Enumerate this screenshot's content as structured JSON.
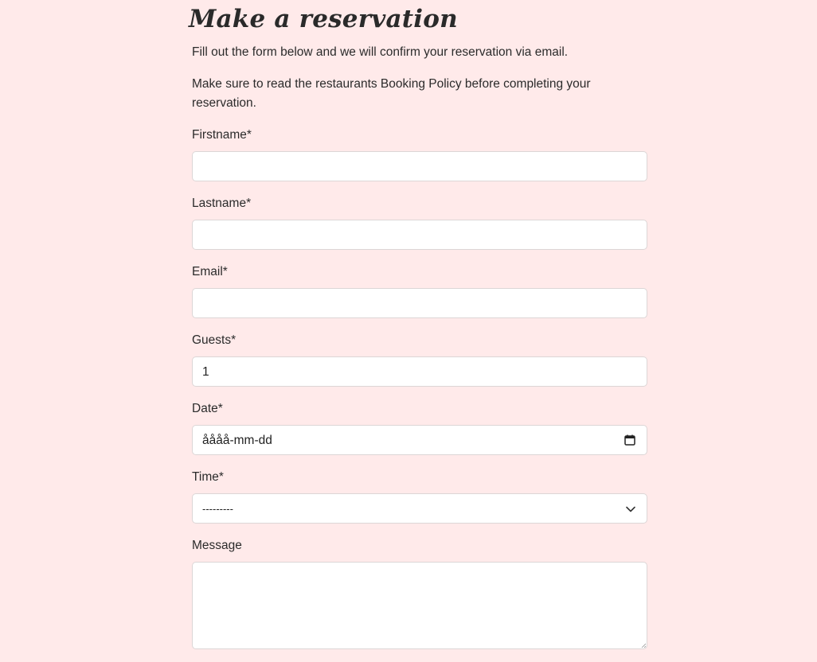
{
  "page": {
    "title": "Make a reservation",
    "intro_1": "Fill out the form below and we will confirm your reservation via email.",
    "intro_2": "Make sure to read the restaurants Booking Policy before completing your reservation."
  },
  "form": {
    "firstname": {
      "label": "Firstname*",
      "value": ""
    },
    "lastname": {
      "label": "Lastname*",
      "value": ""
    },
    "email": {
      "label": "Email*",
      "value": ""
    },
    "guests": {
      "label": "Guests*",
      "value": "1"
    },
    "date": {
      "label": "Date*",
      "placeholder": "åååå-mm-dd",
      "icon": "calendar-icon"
    },
    "time": {
      "label": "Time*",
      "selected": "---------",
      "icon": "chevron-down-icon"
    },
    "message": {
      "label": "Message",
      "value": ""
    }
  },
  "colors": {
    "background": "#ffeaea",
    "field_background": "#ffffff",
    "field_border": "#dcd6d6",
    "text": "#2b2b2b"
  }
}
